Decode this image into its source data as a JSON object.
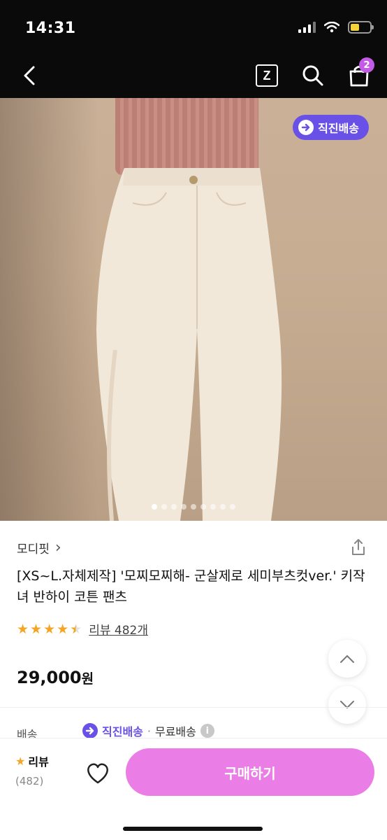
{
  "status_bar": {
    "time": "14:31",
    "battery_level": 0.45
  },
  "nav": {
    "z_label": "Z",
    "cart_count": "2"
  },
  "hero": {
    "direct_badge": "직진배송",
    "slide_count": 9,
    "active_slide": 0
  },
  "product": {
    "brand": "모디핏",
    "brand_chevron": "›",
    "title": "[XS~L.자체제작] '모찌모찌해- 군살제로 세미부츠컷ver.' 키작녀 반하이 코튼 팬츠",
    "rating": 4.5,
    "stars": [
      "★",
      "★",
      "★",
      "★",
      "★"
    ],
    "review_link": "리뷰 482개",
    "price": "29,000",
    "price_unit": "원"
  },
  "shipping": {
    "label": "배송",
    "direct": "직진배송",
    "separator": "·",
    "free": "무료배송",
    "info": "i"
  },
  "bottom_bar": {
    "review_label": "리뷰",
    "review_star": "★",
    "review_count": "(482)",
    "buy_label": "구매하기"
  },
  "colors": {
    "accent_purple": "#6950e6",
    "buy_pink": "#ea7ee6",
    "star": "#f5a524",
    "badge": "#c35be6"
  }
}
